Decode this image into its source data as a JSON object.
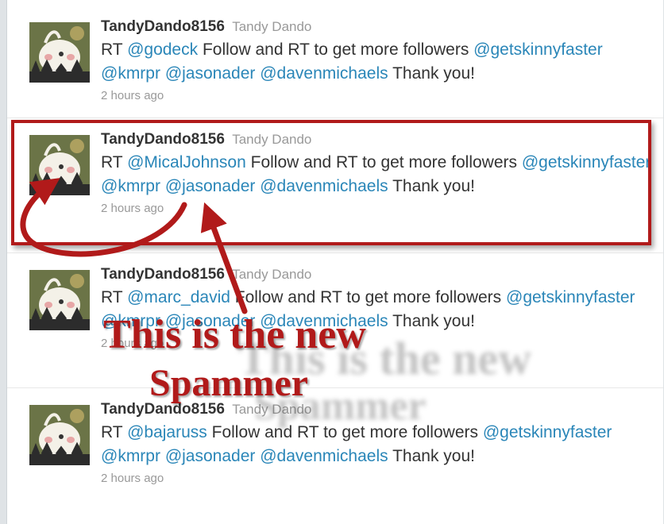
{
  "tweets": [
    {
      "screen_name": "TandyDando8156",
      "real_name": "Tandy Dando",
      "prefix": "RT ",
      "first_mention": "@godeck",
      "middle_text": " Follow and RT to get more followers ",
      "mentions": [
        "@getskinnyfaster",
        "@kmrpr",
        "@jasonader",
        "@davenmichaels"
      ],
      "suffix": " Thank you!",
      "time": "2 hours ago"
    },
    {
      "screen_name": "TandyDando8156",
      "real_name": "Tandy Dando",
      "prefix": "RT ",
      "first_mention": "@MicalJohnson",
      "middle_text": " Follow and RT to get more followers ",
      "mentions": [
        "@getskinnyfaster",
        "@kmrpr",
        "@jasonader",
        "@davenmichaels"
      ],
      "suffix": " Thank you!",
      "time": "2 hours ago"
    },
    {
      "screen_name": "TandyDando8156",
      "real_name": "Tandy Dando",
      "prefix": "RT ",
      "first_mention": "@marc_david",
      "middle_text": " Follow and RT to get more followers ",
      "mentions": [
        "@getskinnyfaster",
        "@kmrpr",
        "@jasonader",
        "@davenmichaels"
      ],
      "suffix": " Thank you!",
      "time": "2 hours ago"
    },
    {
      "screen_name": "TandyDando8156",
      "real_name": "Tandy Dando",
      "prefix": "RT ",
      "first_mention": "@bajaruss",
      "middle_text": " Follow and RT to get more followers ",
      "mentions": [
        "@getskinnyfaster",
        "@kmrpr",
        "@jasonader",
        "@davenmichaels"
      ],
      "suffix": " Thank you!",
      "time": "2 hours ago"
    }
  ],
  "annotation": {
    "line1": "This is the new",
    "line2": "Spammer",
    "color": "#b11a1a"
  },
  "colors": {
    "mention": "#2a86b8",
    "text": "#333333",
    "muted": "#999999"
  }
}
